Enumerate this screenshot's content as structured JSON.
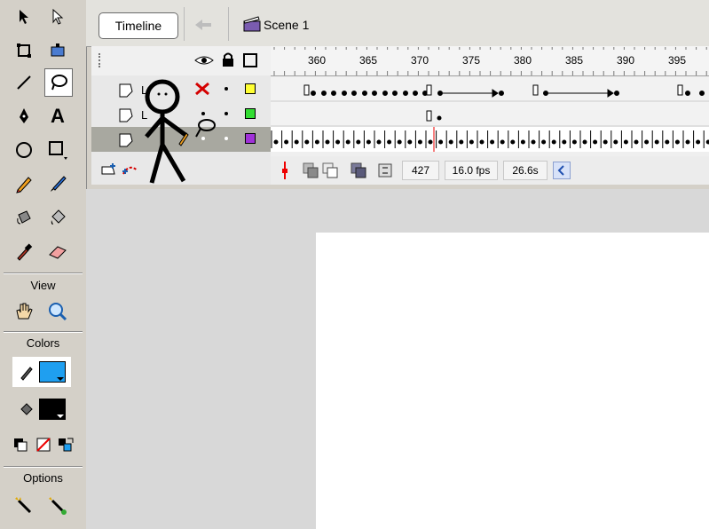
{
  "toolbar": {
    "view_label": "View",
    "colors_label": "Colors",
    "options_label": "Options",
    "stroke_color": "#1f9ff0",
    "fill_color": "#000000"
  },
  "timeline": {
    "tab_label": "Timeline",
    "scene_label": "Scene 1",
    "ruler_numbers": [
      "360",
      "365",
      "370",
      "375",
      "380",
      "385",
      "390",
      "395"
    ],
    "layers": [
      {
        "name": "L",
        "color": "#ffff33",
        "selected": false
      },
      {
        "name": "L",
        "color": "#33dd33",
        "selected": false
      },
      {
        "name": "",
        "color": "#a031d8",
        "selected": true
      }
    ],
    "status": {
      "current_frame": "427",
      "fps": "16.0 fps",
      "elapsed": "26.6s"
    }
  },
  "icons": {
    "eye": "eye-icon",
    "lock": "lock-icon",
    "outline": "outline-icon",
    "arrow": "selection-arrow-icon",
    "subselect": "subselection-icon"
  }
}
